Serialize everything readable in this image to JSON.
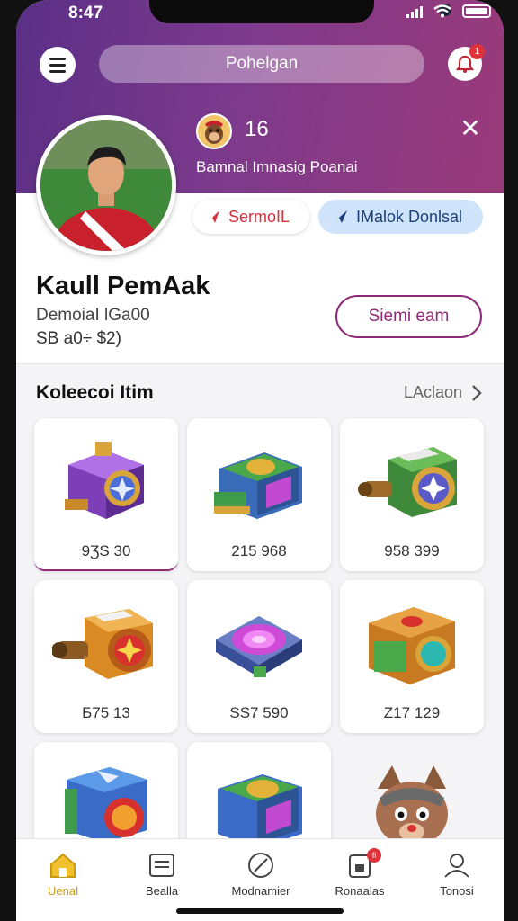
{
  "status_bar": {
    "time": "8:47"
  },
  "header": {
    "search_placeholder": "Pohelgan",
    "notification_badge": "1"
  },
  "profile": {
    "level": "16",
    "tagline": "Bamnal Imnasig Poanai",
    "chip_red": "SermoIL",
    "chip_blue": "IMalok Donlsal",
    "name": "Kaull PemAak",
    "subtitle_line1": "DemoiaI lGa00",
    "subtitle_line2": "SB a0÷ $2)",
    "follow_button": "Siemi eam"
  },
  "collection": {
    "title": "Koleecoi Itim",
    "link": "LAclaon",
    "items": [
      {
        "price": "9ƷS 30",
        "icon": "purple-chest-icon",
        "color": "#8a4bd0"
      },
      {
        "price": "215 968",
        "icon": "green-chest-icon",
        "color": "#3f9a4a"
      },
      {
        "price": "958 399",
        "icon": "cannon-chest-icon",
        "color": "#4aa84a"
      },
      {
        "price": "Б75 13",
        "icon": "orange-cannon-icon",
        "color": "#d98a24"
      },
      {
        "price": "SS7 590",
        "icon": "pink-pad-icon",
        "color": "#c24ad0"
      },
      {
        "price": "Z17 129",
        "icon": "orange-crate-icon",
        "color": "#d98a24"
      },
      {
        "price": "",
        "icon": "blue-box-icon",
        "color": "#3a6cc7"
      },
      {
        "price": "",
        "icon": "yellow-box-icon",
        "color": "#e2b23a"
      },
      {
        "price": "",
        "icon": "wolf-icon",
        "color": "#8a5a3a"
      }
    ]
  },
  "bottom_nav": [
    {
      "label": "Uenal",
      "icon": "home-icon"
    },
    {
      "label": "Bealla",
      "icon": "list-icon"
    },
    {
      "label": "Modnamier",
      "icon": "compass-icon"
    },
    {
      "label": "Ronaalas",
      "icon": "clipboard-icon",
      "badge": "fi"
    },
    {
      "label": "Tonosi",
      "icon": "profile-icon"
    }
  ],
  "colors": {
    "accent": "#8f2a77",
    "hero_start": "#5a2f86",
    "hero_end": "#9a3a7a",
    "active_nav": "#c99a10"
  }
}
